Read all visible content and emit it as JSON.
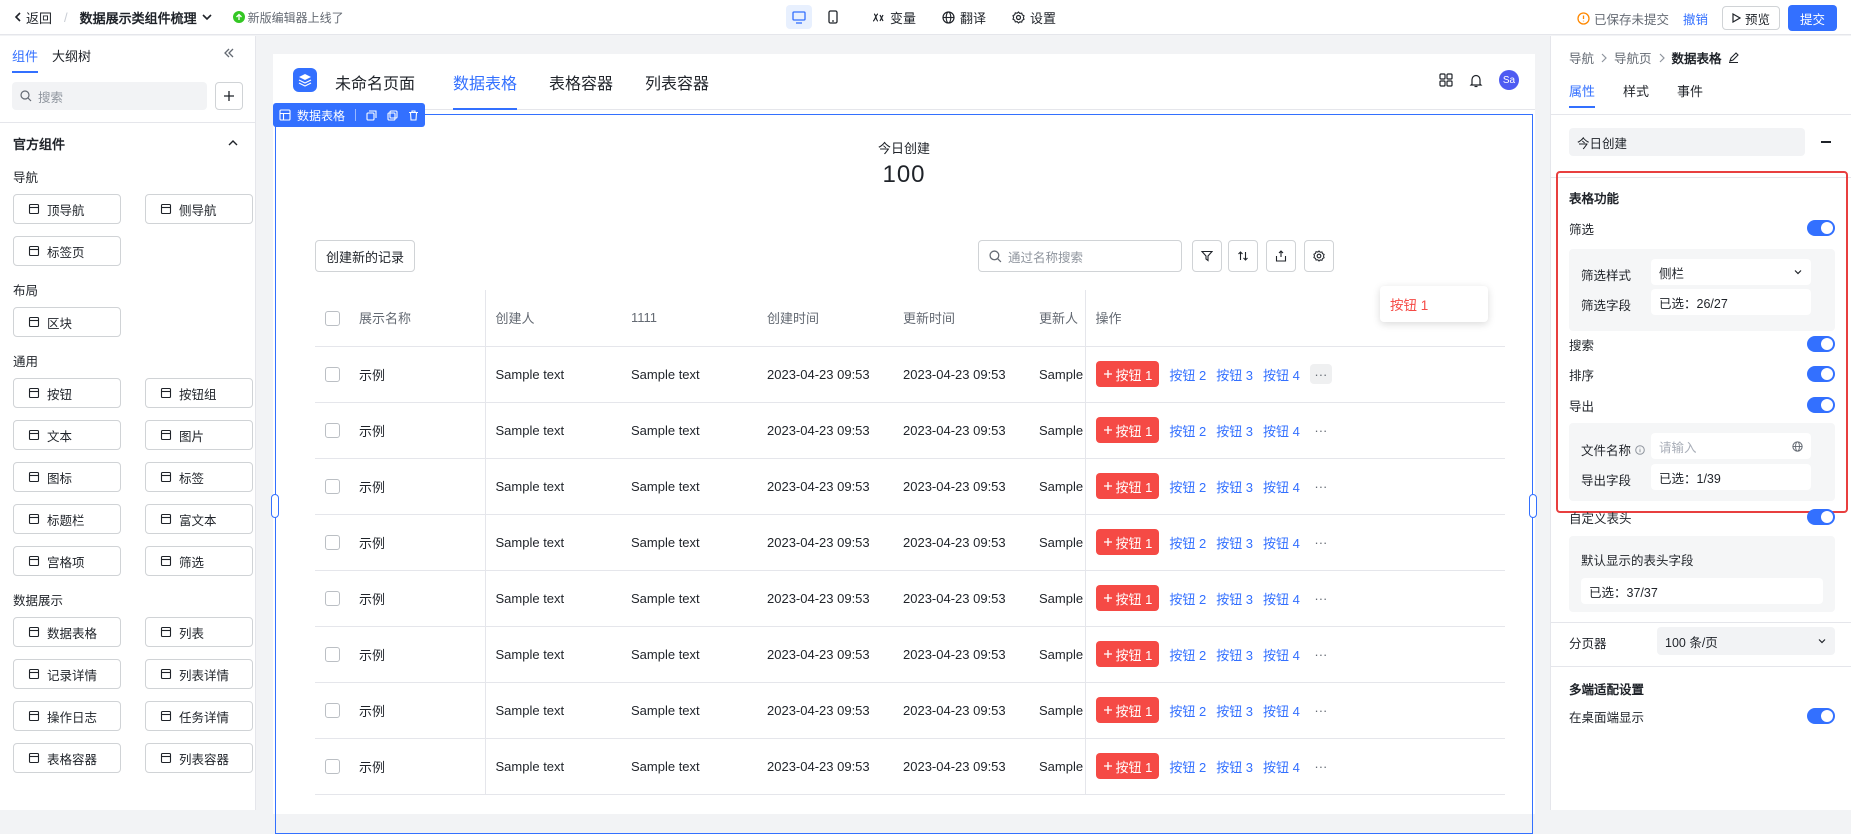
{
  "topbar": {
    "back": "返回",
    "separator": "/",
    "title": "数据展示类组件梳理",
    "notice": "新版编辑器上线了",
    "tools": [
      "变量",
      "翻译",
      "设置"
    ],
    "unsaved": "已保存未提交",
    "undo": "撤销",
    "preview": "预览",
    "submit": "提交"
  },
  "left": {
    "tabs": [
      "组件",
      "大纲树"
    ],
    "search_placeholder": "搜索",
    "section": "官方组件",
    "groups": [
      {
        "name": "导航",
        "items": [
          {
            "label": "顶导航",
            "icon": "top-nav-icon"
          },
          {
            "label": "侧导航",
            "icon": "side-nav-icon"
          },
          {
            "label": "标签页",
            "icon": "tabs-icon"
          }
        ]
      },
      {
        "name": "布局",
        "items": [
          {
            "label": "区块",
            "icon": "block-icon"
          }
        ]
      },
      {
        "name": "通用",
        "items": [
          {
            "label": "按钮",
            "icon": "button-icon"
          },
          {
            "label": "按钮组",
            "icon": "button-group-icon"
          },
          {
            "label": "文本",
            "icon": "text-icon"
          },
          {
            "label": "图片",
            "icon": "image-icon"
          },
          {
            "label": "图标",
            "icon": "smile-icon"
          },
          {
            "label": "标签",
            "icon": "tag-icon"
          },
          {
            "label": "标题栏",
            "icon": "heading-icon"
          },
          {
            "label": "富文本",
            "icon": "rich-text-icon"
          },
          {
            "label": "宫格项",
            "icon": "grid-icon"
          },
          {
            "label": "筛选",
            "icon": "filter-icon"
          }
        ]
      },
      {
        "name": "数据展示",
        "items": [
          {
            "label": "数据表格",
            "icon": "table-icon"
          },
          {
            "label": "列表",
            "icon": "list-icon"
          },
          {
            "label": "记录详情",
            "icon": "record-icon"
          },
          {
            "label": "列表详情",
            "icon": "list-detail-icon"
          },
          {
            "label": "操作日志",
            "icon": "log-icon"
          },
          {
            "label": "任务详情",
            "icon": "task-icon"
          },
          {
            "label": "表格容器",
            "icon": "table-container-icon"
          },
          {
            "label": "列表容器",
            "icon": "list-container-icon"
          }
        ]
      }
    ]
  },
  "canvas": {
    "page_name": "未命名页面",
    "nav": [
      "数据表格",
      "表格容器",
      "列表容器"
    ],
    "avatar": "Sa",
    "selected_label": "数据表格",
    "stat_label": "今日创建",
    "stat_value": "100",
    "create_button": "创建新的记录",
    "search_placeholder": "通过名称搜索",
    "columns": [
      "展示名称",
      "创建人",
      "1111",
      "创建时间",
      "更新时间",
      "更新人",
      "操作"
    ],
    "rows": [
      [
        "示例",
        "Sample text",
        "Sample text",
        "2023-04-23 09:53",
        "2023-04-23 09:53",
        "Sample text"
      ],
      [
        "示例",
        "Sample text",
        "Sample text",
        "2023-04-23 09:53",
        "2023-04-23 09:53",
        "Sample text"
      ],
      [
        "示例",
        "Sample text",
        "Sample text",
        "2023-04-23 09:53",
        "2023-04-23 09:53",
        "Sample text"
      ],
      [
        "示例",
        "Sample text",
        "Sample text",
        "2023-04-23 09:53",
        "2023-04-23 09:53",
        "Sample text"
      ],
      [
        "示例",
        "Sample text",
        "Sample text",
        "2023-04-23 09:53",
        "2023-04-23 09:53",
        "Sample text"
      ],
      [
        "示例",
        "Sample text",
        "Sample text",
        "2023-04-23 09:53",
        "2023-04-23 09:53",
        "Sample text"
      ],
      [
        "示例",
        "Sample text",
        "Sample text",
        "2023-04-23 09:53",
        "2023-04-23 09:53",
        "Sample text"
      ],
      [
        "示例",
        "Sample text",
        "Sample text",
        "2023-04-23 09:53",
        "2023-04-23 09:53",
        "Sample text"
      ]
    ],
    "action_buttons": [
      "按钮 1",
      "按钮 2",
      "按钮 3",
      "按钮 4"
    ],
    "more": "···",
    "popover_item": "按钮 1"
  },
  "right": {
    "breadcrumb": [
      "导航",
      "导航页",
      "数据表格"
    ],
    "tabs": [
      "属性",
      "样式",
      "事件"
    ],
    "title_value": "今日创建",
    "table_features": "表格功能",
    "filter": "筛选",
    "filter_style_label": "筛选样式",
    "filter_style_value": "侧栏",
    "filter_fields_label": "筛选字段",
    "filter_fields_value": "已选：26/27",
    "search": "搜索",
    "sort": "排序",
    "export": "导出",
    "file_name_label": "文件名称",
    "file_name_placeholder": "请输入",
    "export_fields_label": "导出字段",
    "export_fields_value": "已选：1/39",
    "custom_header": "自定义表头",
    "default_header_label": "默认显示的表头字段",
    "default_header_value": "已选：37/37",
    "pager_label": "分页器",
    "pager_value": "100 条/页",
    "multi_device": "多端适配设置",
    "desktop_show": "在桌面端显示"
  },
  "colors": {
    "accent": "#3370ff",
    "danger": "#f54a45",
    "highlight_box": "#e83f3f"
  }
}
